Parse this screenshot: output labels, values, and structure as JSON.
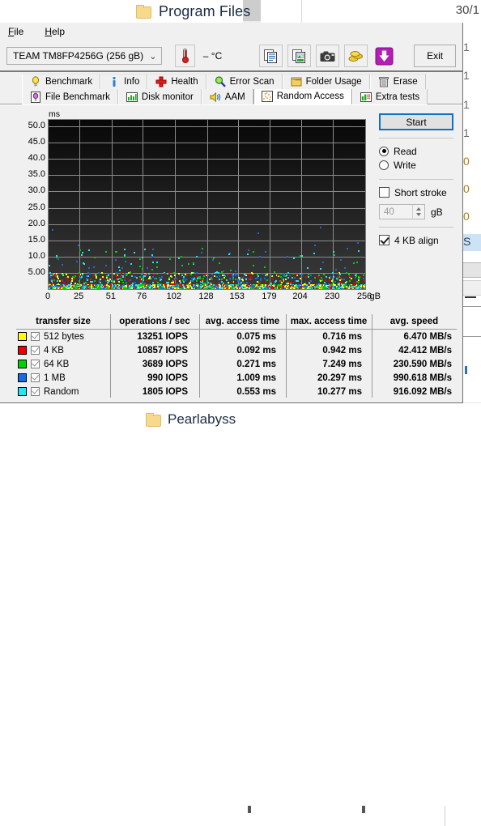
{
  "background_window": {
    "folder_title": "Program Files",
    "date_fragment": "30/1",
    "bottom_folder_title": "Pearlabyss",
    "right_column_fragments": [
      "1",
      "1",
      "1",
      "1",
      "0",
      "0",
      "0",
      "S"
    ]
  },
  "app": {
    "menubar": [
      {
        "label": "File",
        "accel": "F"
      },
      {
        "label": "Help",
        "accel": "H"
      }
    ],
    "toolbar": {
      "drive_selected": "TEAM TM8FP4256G (256 gB)",
      "drive_chevron": "chevron-down-icon",
      "temperature": "– °C",
      "thermometer_icon": "thermometer-icon",
      "buttons": [
        {
          "name": "copy-text-icon",
          "title": "Copy"
        },
        {
          "name": "copy-image-icon",
          "title": "Copy image"
        },
        {
          "name": "camera-icon",
          "title": "Screenshot"
        },
        {
          "name": "coins-icon",
          "title": "Donate"
        },
        {
          "name": "download-icon",
          "title": "Download"
        }
      ],
      "exit_label": "Exit"
    },
    "tabs_row1": [
      {
        "label": "Benchmark",
        "icon": "lightbulb-icon",
        "active": false
      },
      {
        "label": "Info",
        "icon": "info-icon",
        "active": false
      },
      {
        "label": "Health",
        "icon": "health-cross-icon",
        "active": false
      },
      {
        "label": "Error Scan",
        "icon": "magnifier-icon",
        "active": false
      },
      {
        "label": "Folder Usage",
        "icon": "folder-icon",
        "active": false
      },
      {
        "label": "Erase",
        "icon": "trash-icon",
        "active": false
      }
    ],
    "tabs_row2": [
      {
        "label": "File Benchmark",
        "icon": "file-benchmark-icon",
        "active": false
      },
      {
        "label": "Disk monitor",
        "icon": "bar-chart-icon",
        "active": false
      },
      {
        "label": "AAM",
        "icon": "speaker-icon",
        "active": false
      },
      {
        "label": "Random Access",
        "icon": "scatter-icon",
        "active": true
      },
      {
        "label": "Extra tests",
        "icon": "grid-chart-icon",
        "active": false
      }
    ],
    "controls": {
      "start_label": "Start",
      "mode_read_label": "Read",
      "mode_write_label": "Write",
      "mode_selected": "Read",
      "short_stroke_label": "Short stroke",
      "short_stroke_checked": false,
      "short_stroke_value": "40",
      "short_stroke_unit": "gB",
      "align_label": "4 KB align",
      "align_checked": true
    },
    "results": {
      "headers": [
        "transfer size",
        "operations / sec",
        "avg. access time",
        "max. access time",
        "avg. speed"
      ],
      "rows": [
        {
          "color": "#ffff00",
          "checked": true,
          "transfer_size": "512 bytes",
          "ops": "13251 IOPS",
          "avg_access": "0.075 ms",
          "max_access": "0.716 ms",
          "avg_speed": "6.470 MB/s"
        },
        {
          "color": "#ee0000",
          "checked": true,
          "transfer_size": "4 KB",
          "ops": "10857 IOPS",
          "avg_access": "0.092 ms",
          "max_access": "0.942 ms",
          "avg_speed": "42.412 MB/s"
        },
        {
          "color": "#00d200",
          "checked": true,
          "transfer_size": "64 KB",
          "ops": "3689 IOPS",
          "avg_access": "0.271 ms",
          "max_access": "7.249 ms",
          "avg_speed": "230.590 MB/s"
        },
        {
          "color": "#1a6ae0",
          "checked": true,
          "transfer_size": "1 MB",
          "ops": "990 IOPS",
          "avg_access": "1.009 ms",
          "max_access": "20.297 ms",
          "avg_speed": "990.618 MB/s"
        },
        {
          "color": "#25e6f0",
          "checked": true,
          "transfer_size": "Random",
          "ops": "1805 IOPS",
          "avg_access": "0.553 ms",
          "max_access": "10.277 ms",
          "avg_speed": "916.092 MB/s"
        }
      ]
    }
  },
  "chart_data": {
    "type": "scatter",
    "title": "",
    "xlabel": "gB",
    "ylabel": "ms",
    "xlim": [
      0,
      256
    ],
    "ylim": [
      0,
      52
    ],
    "grid": true,
    "xticks": [
      "0",
      "25",
      "51",
      "76",
      "102",
      "128",
      "153",
      "179",
      "204",
      "230",
      "256"
    ],
    "xtick_values": [
      0,
      25,
      51,
      76,
      102,
      128,
      153,
      179,
      204,
      230,
      256
    ],
    "yticks": [
      "5.00",
      "10.0",
      "15.0",
      "20.0",
      "25.0",
      "30.0",
      "35.0",
      "40.0",
      "45.0",
      "50.0"
    ],
    "ytick_values": [
      5,
      10,
      15,
      20,
      25,
      30,
      35,
      40,
      45,
      50
    ],
    "series": [
      {
        "name": "512 bytes",
        "color": "#ffff00",
        "avg_ms": 0.075,
        "max_ms": 0.716,
        "iops": 13251,
        "speed_mbs": 6.47
      },
      {
        "name": "4 KB",
        "color": "#ee0000",
        "avg_ms": 0.092,
        "max_ms": 0.942,
        "iops": 10857,
        "speed_mbs": 42.412
      },
      {
        "name": "64 KB",
        "color": "#00d200",
        "avg_ms": 0.271,
        "max_ms": 7.249,
        "iops": 3689,
        "speed_mbs": 230.59
      },
      {
        "name": "1 MB",
        "color": "#1a6ae0",
        "avg_ms": 1.009,
        "max_ms": 20.297,
        "iops": 990,
        "speed_mbs": 990.618
      },
      {
        "name": "Random",
        "color": "#25e6f0",
        "avg_ms": 0.553,
        "max_ms": 10.277,
        "iops": 1805,
        "speed_mbs": 916.092
      }
    ]
  }
}
